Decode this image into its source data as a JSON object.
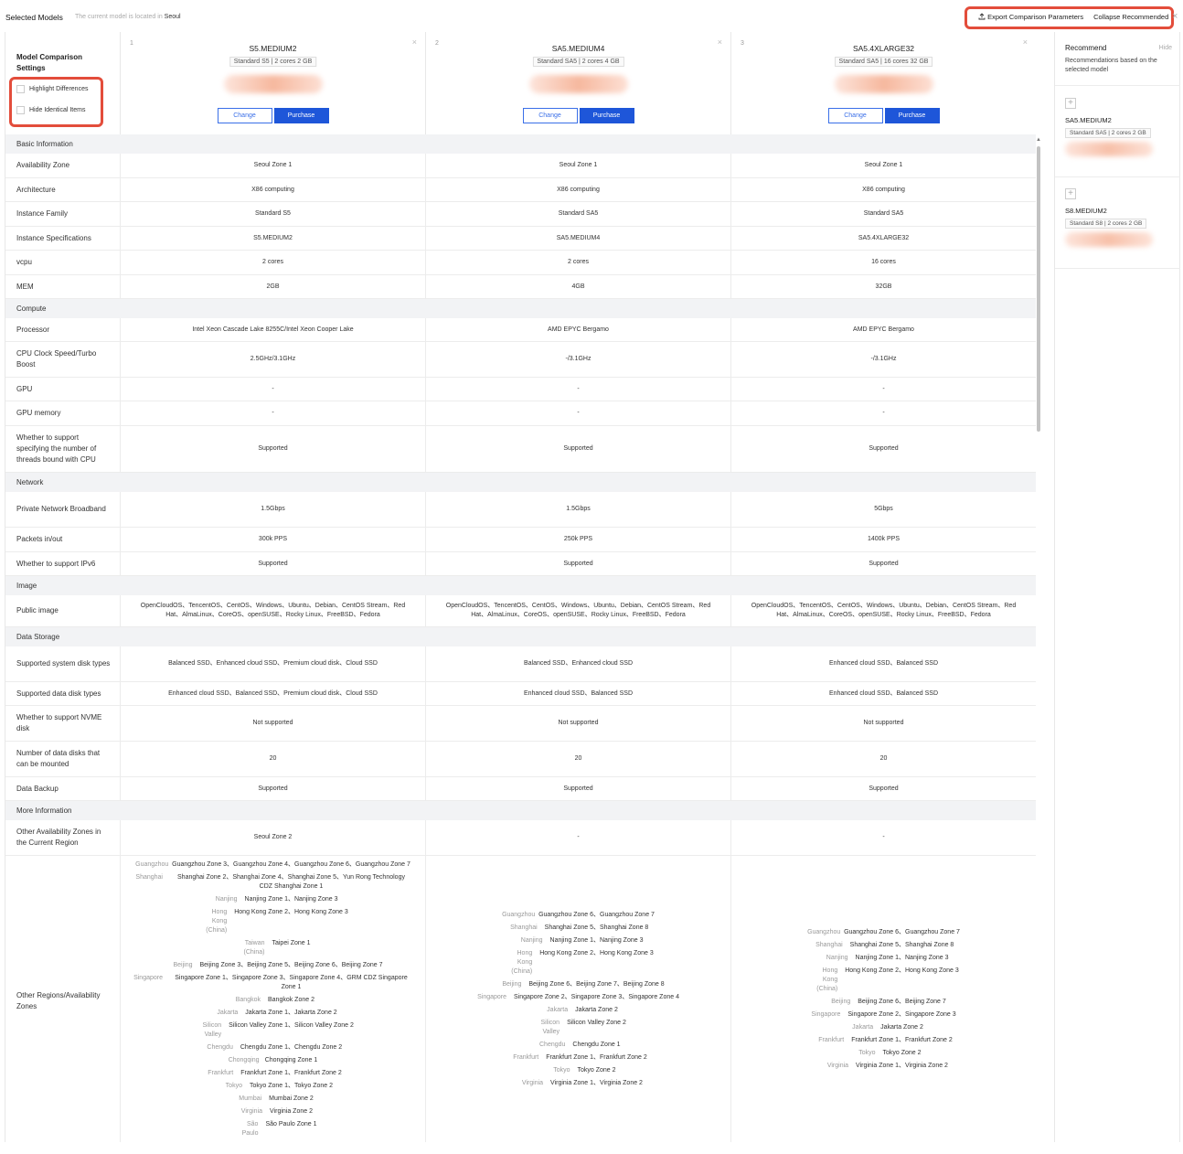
{
  "header": {
    "title": "Selected Models",
    "location_prefix": "The current model is located in",
    "location": "Seoul",
    "export_label": "Export Comparison Parameters",
    "collapse_label": "Collapse Recommended",
    "close": "×"
  },
  "settings": {
    "title": "Model Comparison Settings",
    "highlight_label": "Highlight Differences",
    "hide_identical_label": "Hide Identical Items"
  },
  "models": [
    {
      "index": "1",
      "name": "S5.MEDIUM2",
      "spec": "Standard S5 | 2 cores 2 GB",
      "change": "Change",
      "purchase": "Purchase",
      "close": "×"
    },
    {
      "index": "2",
      "name": "SA5.MEDIUM4",
      "spec": "Standard SA5 | 2 cores 4 GB",
      "change": "Change",
      "purchase": "Purchase",
      "close": "×"
    },
    {
      "index": "3",
      "name": "SA5.4XLARGE32",
      "spec": "Standard SA5 | 16 cores 32 GB",
      "change": "Change",
      "purchase": "Purchase",
      "close": "×"
    }
  ],
  "sections": {
    "basic": "Basic Information",
    "compute": "Compute",
    "network": "Network",
    "image": "Image",
    "storage": "Data Storage",
    "more": "More Information"
  },
  "rows": {
    "az": {
      "label": "Availability Zone",
      "v": [
        "Seoul Zone 1",
        "Seoul Zone 1",
        "Seoul Zone 1"
      ]
    },
    "arch": {
      "label": "Architecture",
      "v": [
        "X86 computing",
        "X86 computing",
        "X86 computing"
      ]
    },
    "family": {
      "label": "Instance Family",
      "v": [
        "Standard S5",
        "Standard SA5",
        "Standard SA5"
      ]
    },
    "spec": {
      "label": "Instance Specifications",
      "v": [
        "S5.MEDIUM2",
        "SA5.MEDIUM4",
        "SA5.4XLARGE32"
      ]
    },
    "vcpu": {
      "label": "vcpu",
      "v": [
        "2 cores",
        "2 cores",
        "16 cores"
      ]
    },
    "mem": {
      "label": "MEM",
      "v": [
        "2GB",
        "4GB",
        "32GB"
      ]
    },
    "proc": {
      "label": "Processor",
      "v": [
        "Intel Xeon Cascade Lake 8255C/Intel Xeon Cooper Lake",
        "AMD EPYC Bergamo",
        "AMD EPYC Bergamo"
      ]
    },
    "clock": {
      "label": "CPU Clock Speed/Turbo Boost",
      "v": [
        "2.5GHz/3.1GHz",
        "-/3.1GHz",
        "-/3.1GHz"
      ]
    },
    "gpu": {
      "label": "GPU",
      "v": [
        "-",
        "-",
        "-"
      ]
    },
    "gpumem": {
      "label": "GPU memory",
      "v": [
        "-",
        "-",
        "-"
      ]
    },
    "threads": {
      "label": "Whether to support specifying the number of threads bound with CPU",
      "v": [
        "Supported",
        "Supported",
        "Supported"
      ]
    },
    "bw": {
      "label": "Private Network Broadband",
      "v": [
        "1.5Gbps",
        "1.5Gbps",
        "5Gbps"
      ]
    },
    "pps": {
      "label": "Packets in/out",
      "v": [
        "300k PPS",
        "250k PPS",
        "1400k PPS"
      ]
    },
    "ipv6": {
      "label": "Whether to support IPv6",
      "v": [
        "Supported",
        "Supported",
        "Supported"
      ]
    },
    "pubimg": {
      "label": "Public image",
      "v": [
        "OpenCloudOS、TencentOS、CentOS、Windows、Ubuntu、Debian、CentOS Stream、Red Hat、AlmaLinux、CoreOS、openSUSE、Rocky Linux、FreeBSD、Fedora",
        "OpenCloudOS、TencentOS、CentOS、Windows、Ubuntu、Debian、CentOS Stream、Red Hat、AlmaLinux、CoreOS、openSUSE、Rocky Linux、FreeBSD、Fedora",
        "OpenCloudOS、TencentOS、CentOS、Windows、Ubuntu、Debian、CentOS Stream、Red Hat、AlmaLinux、CoreOS、openSUSE、Rocky Linux、FreeBSD、Fedora"
      ]
    },
    "sysdisk": {
      "label": "Supported system disk types",
      "v": [
        "Balanced SSD、Enhanced cloud SSD、Premium cloud disk、Cloud SSD",
        "Balanced SSD、Enhanced cloud SSD",
        "Enhanced cloud SSD、Balanced SSD"
      ]
    },
    "datadisk": {
      "label": "Supported data disk types",
      "v": [
        "Enhanced cloud SSD、Balanced SSD、Premium cloud disk、Cloud SSD",
        "Enhanced cloud SSD、Balanced SSD",
        "Enhanced cloud SSD、Balanced SSD"
      ]
    },
    "nvme": {
      "label": "Whether to support NVME disk",
      "v": [
        "Not supported",
        "Not supported",
        "Not supported"
      ]
    },
    "ndisks": {
      "label": "Number of data disks that can be mounted",
      "v": [
        "20",
        "20",
        "20"
      ]
    },
    "backup": {
      "label": "Data Backup",
      "v": [
        "Supported",
        "Supported",
        "Supported"
      ]
    },
    "otheraz": {
      "label": "Other Availability Zones in the Current Region",
      "v": [
        "Seoul Zone 2",
        "-",
        "-"
      ]
    },
    "otherreg": {
      "label": "Other Regions/Availability Zones"
    }
  },
  "regions": [
    [
      {
        "r": "Guangzhou",
        "z": "Guangzhou Zone 3、Guangzhou Zone 4、Guangzhou Zone 6、Guangzhou Zone 7"
      },
      {
        "r": "Shanghai",
        "z": "Shanghai Zone 2、Shanghai Zone 4、Shanghai Zone 5、Yun Rong Technology CDZ Shanghai Zone 1"
      },
      {
        "r": "Nanjing",
        "z": "Nanjing Zone 1、Nanjing Zone 3"
      },
      {
        "r": "Hong Kong (China)",
        "z": "Hong Kong Zone 2、Hong Kong Zone 3"
      },
      {
        "r": "Taiwan (China)",
        "z": "Taipei Zone 1"
      },
      {
        "r": "Beijing",
        "z": "Beijing Zone 3、Beijing Zone 5、Beijing Zone 6、Beijing Zone 7"
      },
      {
        "r": "Singapore",
        "z": "Singapore Zone 1、Singapore Zone 3、Singapore Zone 4、GRM CDZ Singapore Zone 1"
      },
      {
        "r": "Bangkok",
        "z": "Bangkok Zone 2"
      },
      {
        "r": "Jakarta",
        "z": "Jakarta Zone 1、Jakarta Zone 2"
      },
      {
        "r": "Silicon Valley",
        "z": "Silicon Valley Zone 1、Silicon Valley Zone 2"
      },
      {
        "r": "Chengdu",
        "z": "Chengdu Zone 1、Chengdu Zone 2"
      },
      {
        "r": "Chongqing",
        "z": "Chongqing Zone 1"
      },
      {
        "r": "Frankfurt",
        "z": "Frankfurt Zone 1、Frankfurt Zone 2"
      },
      {
        "r": "Tokyo",
        "z": "Tokyo Zone 1、Tokyo Zone 2"
      },
      {
        "r": "Mumbai",
        "z": "Mumbai Zone 2"
      },
      {
        "r": "Virginia",
        "z": "Virginia Zone 2"
      },
      {
        "r": "São Paulo",
        "z": "São Paulo Zone 1"
      }
    ],
    [
      {
        "r": "Guangzhou",
        "z": "Guangzhou Zone 6、Guangzhou Zone 7"
      },
      {
        "r": "Shanghai",
        "z": "Shanghai Zone 5、Shanghai Zone 8"
      },
      {
        "r": "Nanjing",
        "z": "Nanjing Zone 1、Nanjing Zone 3"
      },
      {
        "r": "Hong Kong (China)",
        "z": "Hong Kong Zone 2、Hong Kong Zone 3"
      },
      {
        "r": "Beijing",
        "z": "Beijing Zone 6、Beijing Zone 7、Beijing Zone 8"
      },
      {
        "r": "Singapore",
        "z": "Singapore Zone 2、Singapore Zone 3、Singapore Zone 4"
      },
      {
        "r": "Jakarta",
        "z": "Jakarta Zone 2"
      },
      {
        "r": "Silicon Valley",
        "z": "Silicon Valley Zone 2"
      },
      {
        "r": "Chengdu",
        "z": "Chengdu Zone 1"
      },
      {
        "r": "Frankfurt",
        "z": "Frankfurt Zone 1、Frankfurt Zone 2"
      },
      {
        "r": "Tokyo",
        "z": "Tokyo Zone 2"
      },
      {
        "r": "Virginia",
        "z": "Virginia Zone 1、Virginia Zone 2"
      }
    ],
    [
      {
        "r": "Guangzhou",
        "z": "Guangzhou Zone 6、Guangzhou Zone 7"
      },
      {
        "r": "Shanghai",
        "z": "Shanghai Zone 5、Shanghai Zone 8"
      },
      {
        "r": "Nanjing",
        "z": "Nanjing Zone 1、Nanjing Zone 3"
      },
      {
        "r": "Hong Kong (China)",
        "z": "Hong Kong Zone 2、Hong Kong Zone 3"
      },
      {
        "r": "Beijing",
        "z": "Beijing Zone 6、Beijing Zone 7"
      },
      {
        "r": "Singapore",
        "z": "Singapore Zone 2、Singapore Zone 3"
      },
      {
        "r": "Jakarta",
        "z": "Jakarta Zone 2"
      },
      {
        "r": "Frankfurt",
        "z": "Frankfurt Zone 1、Frankfurt Zone 2"
      },
      {
        "r": "Tokyo",
        "z": "Tokyo Zone 2"
      },
      {
        "r": "Virginia",
        "z": "Virginia Zone 1、Virginia Zone 2"
      }
    ]
  ],
  "recommend": {
    "title": "Recommend",
    "hide": "Hide",
    "desc": "Recommendations based on the selected model",
    "items": [
      {
        "name": "SA5.MEDIUM2",
        "spec": "Standard SA5 | 2 cores 2 GB",
        "plus": "+"
      },
      {
        "name": "S8.MEDIUM2",
        "spec": "Standard S8 | 2 cores 2 GB",
        "plus": "+"
      }
    ]
  },
  "colors": {
    "accent": "#1e56d9",
    "highlight_box": "#e34d3b"
  },
  "icons": {
    "export": "upload-icon",
    "close": "close-icon",
    "add": "plus-icon"
  }
}
